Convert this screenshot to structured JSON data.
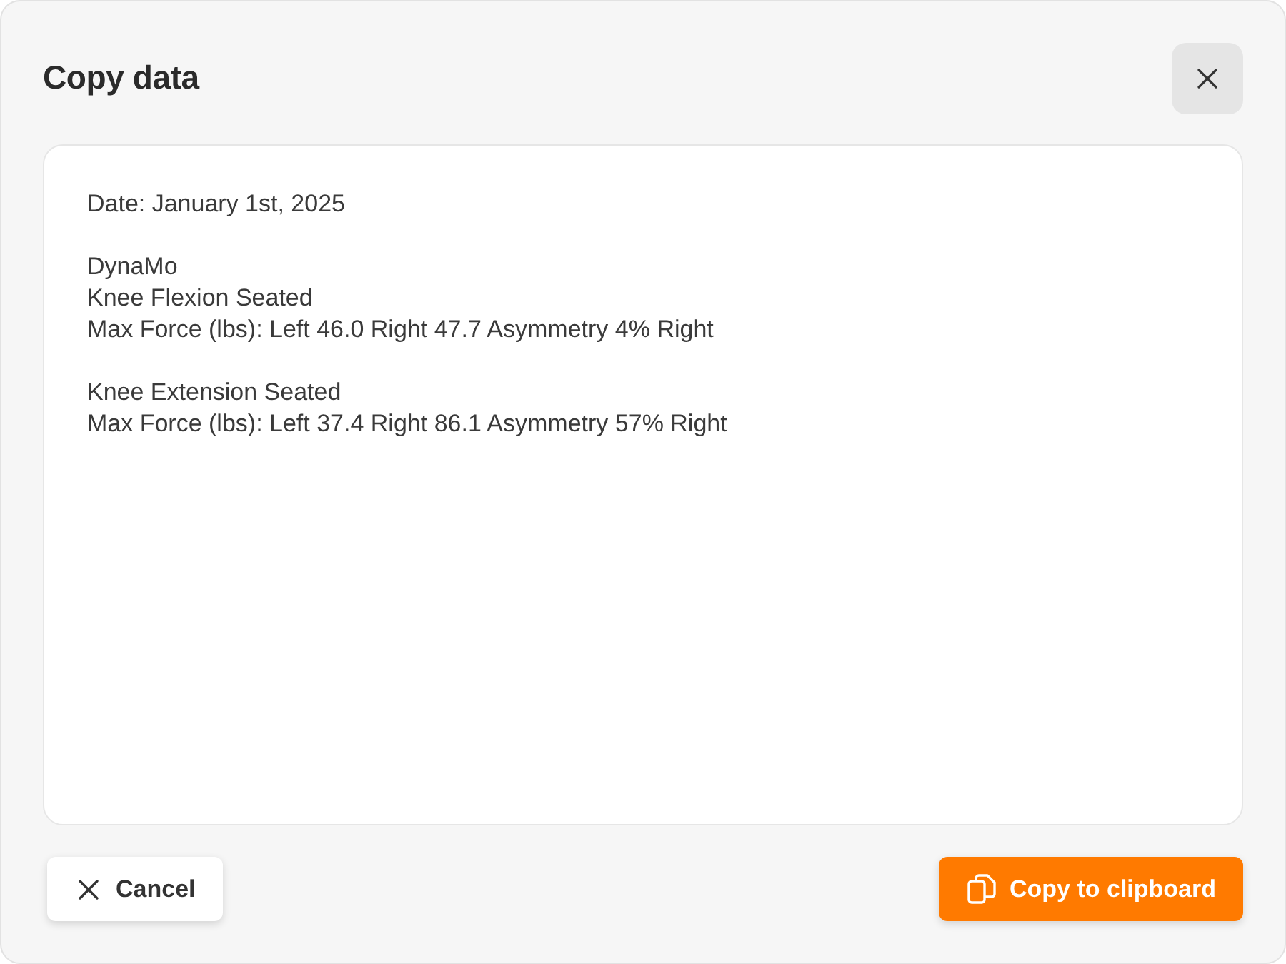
{
  "dialog": {
    "title": "Copy data"
  },
  "content": {
    "paragraphs": [
      [
        "Date: January 1st, 2025"
      ],
      [
        "DynaMo",
        "Knee Flexion Seated",
        "Max Force (lbs): Left 46.0 Right 47.7 Asymmetry 4% Right"
      ],
      [
        "Knee Extension Seated",
        "Max Force (lbs): Left 37.4 Right 86.1 Asymmetry 57% Right"
      ]
    ]
  },
  "buttons": [
    {
      "kind": "cancel",
      "label": "Cancel"
    },
    {
      "kind": "copy",
      "label": "Copy to clipboard"
    }
  ]
}
